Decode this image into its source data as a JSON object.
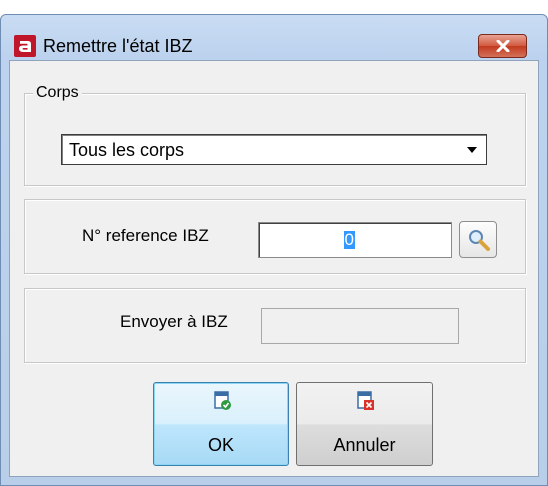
{
  "window": {
    "title": "Remettre l'état IBZ",
    "app_icon": "app-logo-a",
    "close_icon": "close-x-icon"
  },
  "corps": {
    "legend": "Corps",
    "selected": "Tous les corps"
  },
  "reference": {
    "label": "N° reference IBZ",
    "value": "0",
    "search_icon": "magnifier-icon"
  },
  "send": {
    "label": "Envoyer à IBZ",
    "value": ""
  },
  "buttons": {
    "ok": {
      "label": "OK",
      "icon": "document-check-icon"
    },
    "cancel": {
      "label": "Annuler",
      "icon": "document-delete-icon"
    }
  },
  "colors": {
    "ok_border": "#3c7fb1",
    "close_button": "#c23b1f",
    "selection": "#3399ff"
  }
}
